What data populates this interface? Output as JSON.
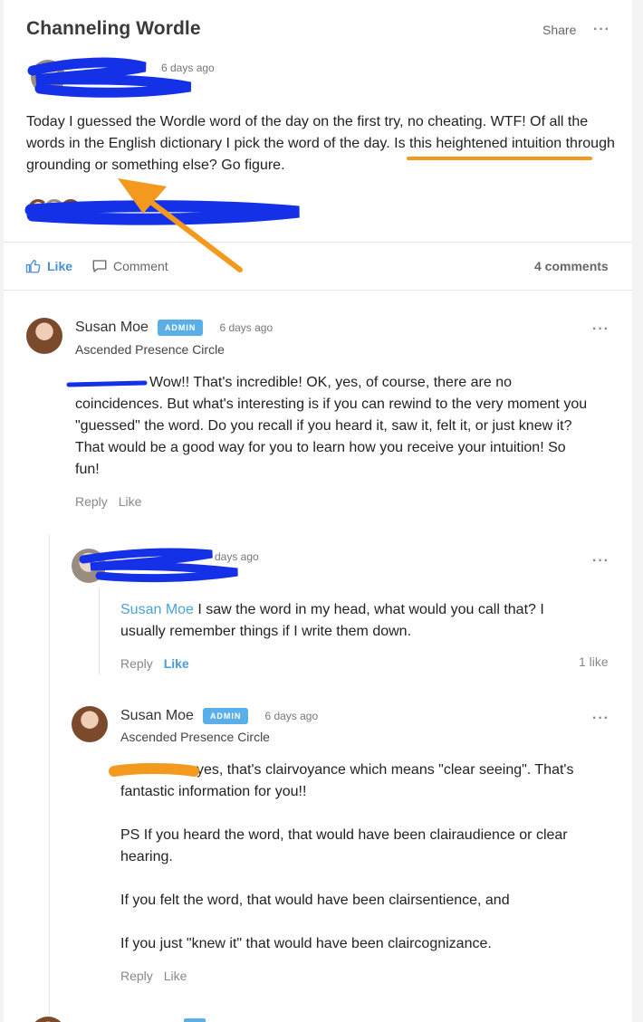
{
  "post": {
    "title": "Channeling Wordle",
    "share_label": "Share",
    "more_icon": "···",
    "time": "6 days ago",
    "body": "Today I guessed the Wordle word of the day on the first try, no cheating. WTF! Of all the words in the English dictionary I pick the word of the day. Is this heightened intuition through grounding or something else? Go figure.",
    "like_label": "Like",
    "comment_label": "Comment",
    "comments_count": "4 comments"
  },
  "comments": [
    {
      "author": "Susan Moe",
      "badge": "ADMIN",
      "time": "6 days ago",
      "group": "Ascended Presence Circle",
      "text": "Wow!! That's incredible! OK, yes, of course, there are no coincidences. But what's interesting is if you can rewind to the very moment you \"guessed\" the word. Do you recall if you heard it, saw it, felt it, or just knew it? That would be a good way for you to learn how you receive your intuition! So fun!",
      "reply_label": "Reply",
      "like_label": "Like"
    },
    {
      "time": "days ago",
      "mention": "Susan Moe",
      "text": " I saw the word in my head, what would you call that?  I usually remember things if I write them down.",
      "reply_label": "Reply",
      "like_label": "Like",
      "likes": "1 like"
    },
    {
      "author": "Susan Moe",
      "badge": "ADMIN",
      "time": "6 days ago",
      "group": "Ascended Presence Circle",
      "text_p1": "yes, that's clairvoyance which means \"clear seeing\". That's fantastic information for you!!",
      "text_p2": "PS If you heard the word, that would have been clairaudience or clear hearing.",
      "text_p3": "If you felt the word, that would have been clairsentience, and",
      "text_p4": "If you just \"knew it\" that would have been claircognizance.",
      "reply_label": "Reply",
      "like_label": "Like"
    }
  ],
  "icons": {
    "like": "thumbs-up-icon",
    "comment": "speech-bubble-icon",
    "more": "more-dots-icon"
  },
  "colors": {
    "accent": "#4a8fd6",
    "badge": "#5aafe8",
    "redaction_blue": "#1431e8",
    "annotation_orange": "#f39a1e"
  }
}
